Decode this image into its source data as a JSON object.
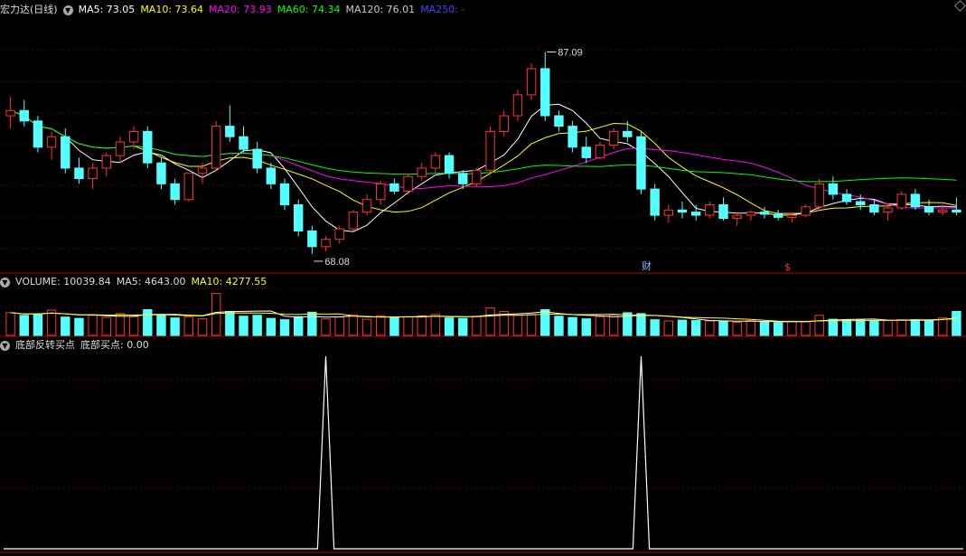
{
  "main_panel": {
    "title": "宏力达(日线)",
    "ma5": "MA5: 73.05",
    "ma10": "MA10: 73.64",
    "ma20": "MA20: 73.93",
    "ma60": "MA60: 74.34",
    "ma120": "MA120: 76.01",
    "ma250": "MA250: -",
    "high_label": "87.09",
    "low_label": "68.08",
    "marker_cai": "财",
    "marker_s": "$"
  },
  "volume_panel": {
    "volume": "VOLUME: 10039.84",
    "ma5": "MA5: 4643.00",
    "ma10": "MA10: 4277.55"
  },
  "indicator_panel": {
    "name": "底部反转买点",
    "value": "底部买点: 0.00"
  },
  "colors": {
    "up": "#ff3232",
    "down": "#54ffff",
    "ma5": "#ffffff",
    "ma10": "#ffff00",
    "ma20": "#ff00ff",
    "ma60": "#00ff00",
    "ma120": "#cccccc",
    "ma250": "#4444ff",
    "grid": "#8b0000"
  },
  "chart_data": [
    {
      "type": "candlestick",
      "price_range": [
        66.5,
        90.5
      ],
      "ohlc": [
        [
          81.0,
          82.8,
          79.8,
          81.5
        ],
        [
          81.5,
          82.5,
          80.0,
          80.5
        ],
        [
          80.5,
          81.0,
          77.5,
          78.0
        ],
        [
          78.0,
          79.5,
          76.8,
          79.0
        ],
        [
          79.0,
          79.8,
          75.5,
          76.0
        ],
        [
          76.0,
          77.0,
          74.5,
          75.0
        ],
        [
          75.0,
          76.5,
          74.0,
          76.0
        ],
        [
          76.0,
          77.5,
          75.2,
          77.2
        ],
        [
          77.2,
          79.0,
          76.5,
          78.5
        ],
        [
          78.5,
          80.0,
          77.8,
          79.5
        ],
        [
          79.5,
          80.0,
          76.0,
          76.5
        ],
        [
          76.5,
          77.0,
          74.0,
          74.5
        ],
        [
          74.5,
          75.0,
          72.5,
          73.0
        ],
        [
          73.0,
          75.5,
          72.8,
          75.5
        ],
        [
          75.5,
          76.5,
          74.5,
          76.0
        ],
        [
          76.0,
          80.5,
          75.8,
          80.0
        ],
        [
          80.0,
          82.0,
          78.5,
          79.0
        ],
        [
          79.0,
          80.0,
          77.5,
          77.8
        ],
        [
          77.8,
          78.5,
          75.5,
          76.0
        ],
        [
          76.0,
          76.5,
          74.0,
          74.5
        ],
        [
          74.5,
          75.0,
          72.0,
          72.5
        ],
        [
          72.5,
          73.0,
          69.5,
          70.0
        ],
        [
          70.0,
          70.5,
          67.8,
          68.5
        ],
        [
          68.5,
          69.5,
          68.08,
          69.2
        ],
        [
          69.2,
          70.5,
          68.8,
          70.2
        ],
        [
          70.2,
          72.0,
          70.0,
          71.8
        ],
        [
          71.8,
          73.5,
          71.5,
          73.0
        ],
        [
          73.0,
          74.8,
          72.5,
          74.5
        ],
        [
          74.5,
          75.0,
          73.5,
          73.8
        ],
        [
          73.8,
          75.5,
          73.5,
          75.2
        ],
        [
          75.2,
          76.5,
          74.8,
          76.0
        ],
        [
          76.0,
          77.5,
          75.5,
          77.2
        ],
        [
          77.2,
          77.5,
          75.0,
          75.5
        ],
        [
          75.5,
          75.8,
          74.0,
          74.5
        ],
        [
          74.5,
          76.0,
          74.2,
          75.8
        ],
        [
          75.8,
          80.0,
          75.5,
          79.5
        ],
        [
          79.5,
          81.5,
          79.0,
          81.0
        ],
        [
          81.0,
          83.5,
          80.5,
          83.0
        ],
        [
          83.0,
          86.0,
          82.5,
          85.5
        ],
        [
          85.5,
          87.09,
          80.5,
          81.0
        ],
        [
          81.0,
          81.5,
          79.5,
          80.0
        ],
        [
          80.0,
          80.5,
          77.5,
          78.0
        ],
        [
          78.0,
          79.0,
          76.5,
          77.0
        ],
        [
          77.0,
          78.5,
          76.8,
          78.2
        ],
        [
          78.2,
          79.8,
          77.8,
          79.5
        ],
        [
          79.5,
          80.5,
          78.5,
          79.0
        ],
        [
          79.0,
          79.5,
          73.5,
          74.0
        ],
        [
          74.0,
          74.5,
          71.0,
          71.5
        ],
        [
          71.5,
          72.5,
          70.8,
          72.0
        ],
        [
          72.0,
          72.8,
          71.2,
          71.8
        ],
        [
          71.8,
          72.5,
          71.0,
          71.5
        ],
        [
          71.5,
          72.8,
          71.2,
          72.5
        ],
        [
          72.5,
          73.2,
          71.0,
          71.2
        ],
        [
          71.2,
          71.8,
          70.5,
          71.5
        ],
        [
          71.5,
          72.0,
          71.0,
          71.8
        ],
        [
          71.8,
          72.3,
          71.2,
          71.6
        ],
        [
          71.6,
          72.0,
          71.0,
          71.3
        ],
        [
          71.3,
          71.8,
          70.8,
          71.5
        ],
        [
          71.5,
          72.5,
          71.3,
          72.3
        ],
        [
          72.3,
          75.0,
          72.0,
          74.5
        ],
        [
          74.5,
          75.2,
          73.0,
          73.5
        ],
        [
          73.5,
          74.0,
          72.5,
          72.8
        ],
        [
          72.8,
          73.5,
          72.0,
          72.5
        ],
        [
          72.5,
          73.0,
          71.5,
          71.8
        ],
        [
          71.8,
          72.5,
          71.0,
          72.2
        ],
        [
          72.2,
          73.8,
          72.0,
          73.5
        ],
        [
          73.5,
          74.0,
          72.0,
          72.3
        ],
        [
          72.3,
          73.0,
          71.5,
          71.8
        ],
        [
          71.8,
          72.5,
          71.5,
          72.0
        ],
        [
          72.0,
          73.2,
          71.5,
          71.8
        ]
      ]
    },
    {
      "type": "bar",
      "title": "VOLUME",
      "values": [
        5.2,
        4.6,
        4.9,
        5.8,
        4.2,
        3.9,
        4.6,
        4.1,
        5.0,
        4.3,
        5.9,
        4.8,
        4.0,
        4.2,
        3.8,
        9.6,
        5.5,
        4.4,
        4.6,
        3.9,
        3.6,
        4.3,
        5.3,
        3.8,
        4.2,
        4.7,
        3.7,
        4.5,
        4.1,
        4.3,
        4.5,
        4.8,
        4.0,
        3.9,
        4.4,
        6.3,
        5.5,
        4.6,
        4.8,
        5.9,
        4.4,
        4.1,
        3.8,
        4.3,
        4.7,
        5.2,
        5.0,
        3.6,
        3.3,
        3.5,
        3.4,
        3.3,
        3.2,
        3.0,
        3.4,
        3.1,
        2.9,
        3.2,
        3.1,
        4.6,
        3.7,
        3.6,
        3.5,
        3.3,
        3.4,
        3.6,
        3.6,
        3.5,
        4.0,
        5.5
      ]
    },
    {
      "type": "line",
      "title": "底部反转买点",
      "spikes_at_index": [
        23,
        46
      ]
    }
  ]
}
